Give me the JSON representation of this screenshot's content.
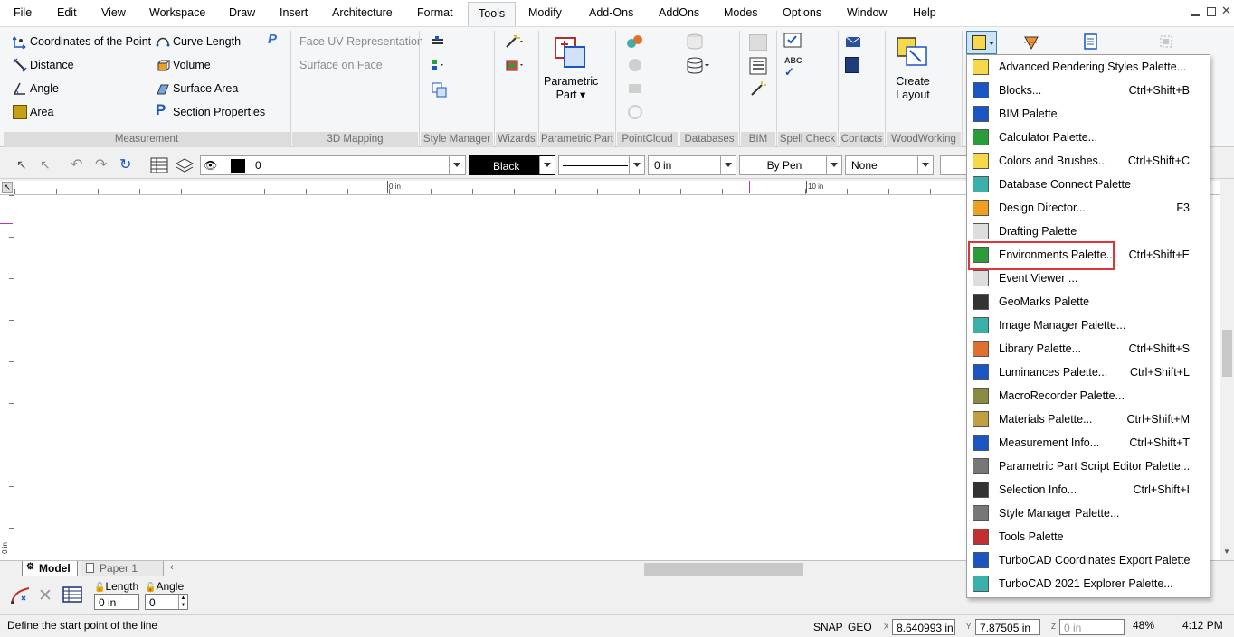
{
  "menu": [
    "File",
    "Edit",
    "View",
    "Workspace",
    "Draw",
    "Insert",
    "Architecture",
    "Format",
    "Tools",
    "Modify",
    "Add-Ons",
    "AddOns",
    "Modes",
    "Options",
    "Window",
    "Help"
  ],
  "measurement": {
    "coords": "Coordinates of the Point",
    "distance": "Distance",
    "angle": "Angle",
    "area": "Area",
    "curve_length": "Curve Length",
    "volume": "Volume",
    "surface_area": "Surface Area",
    "section_properties": "Section Properties"
  },
  "mapping": {
    "face_uv": "Face UV Representation",
    "surface_on_face": "Surface on Face"
  },
  "parametric_part": "Parametric Part",
  "create_layout": "Create Layout",
  "groups": [
    "Measurement",
    "3D Mapping",
    "Style Manager",
    "Wizards",
    "Parametric Part",
    "PointCloud",
    "Databases",
    "BIM",
    "Spell Check",
    "Contacts",
    "WoodWorking"
  ],
  "props": {
    "layer": "0",
    "color": "Black",
    "width": "0 in",
    "pen": "By Pen",
    "fill": "None"
  },
  "ruler": {
    "zero": "0 in",
    "ten": "10 in",
    "v_zero": "0 in"
  },
  "tabs": {
    "model": "Model",
    "paper": "Paper 1"
  },
  "inspector": {
    "length_label": "Length",
    "angle_label": "Angle",
    "length": "0 in",
    "angle": "0"
  },
  "status": {
    "prompt": "Define the start point of the line",
    "snap": "SNAP",
    "geo": "GEO",
    "x": "8.640993 in",
    "y": "7.87505 in",
    "z": "0 in",
    "zoom": "48%",
    "time": "4:12 PM",
    "x_label": "X",
    "y_label": "Y",
    "z_label": "Z"
  },
  "palettes": [
    {
      "label": "Advanced Rendering Styles Palette...",
      "shortcut": ""
    },
    {
      "label": "Blocks...",
      "shortcut": "Ctrl+Shift+B"
    },
    {
      "label": "BIM Palette",
      "shortcut": ""
    },
    {
      "label": "Calculator Palette...",
      "shortcut": ""
    },
    {
      "label": "Colors and Brushes...",
      "shortcut": "Ctrl+Shift+C"
    },
    {
      "label": "Database Connect Palette",
      "shortcut": ""
    },
    {
      "label": "Design Director...",
      "shortcut": "F3"
    },
    {
      "label": "Drafting Palette",
      "shortcut": ""
    },
    {
      "label": "Environments Palette...",
      "shortcut": "Ctrl+Shift+E"
    },
    {
      "label": "Event Viewer ...",
      "shortcut": ""
    },
    {
      "label": "GeoMarks Palette",
      "shortcut": ""
    },
    {
      "label": "Image Manager Palette...",
      "shortcut": ""
    },
    {
      "label": "Library Palette...",
      "shortcut": "Ctrl+Shift+S"
    },
    {
      "label": "Luminances Palette...",
      "shortcut": "Ctrl+Shift+L"
    },
    {
      "label": "MacroRecorder Palette...",
      "shortcut": ""
    },
    {
      "label": "Materials Palette...",
      "shortcut": "Ctrl+Shift+M"
    },
    {
      "label": "Measurement Info...",
      "shortcut": "Ctrl+Shift+T"
    },
    {
      "label": "Parametric Part Script Editor Palette...",
      "shortcut": ""
    },
    {
      "label": "Selection Info...",
      "shortcut": "Ctrl+Shift+I"
    },
    {
      "label": "Style Manager Palette...",
      "shortcut": ""
    },
    {
      "label": "Tools Palette",
      "shortcut": ""
    },
    {
      "label": "TurboCAD Coordinates Export Palette",
      "shortcut": ""
    },
    {
      "label": "TurboCAD 2021 Explorer Palette...",
      "shortcut": ""
    }
  ],
  "colors": {
    "highlight": "#e0343a",
    "accent": "#1a55c4"
  }
}
